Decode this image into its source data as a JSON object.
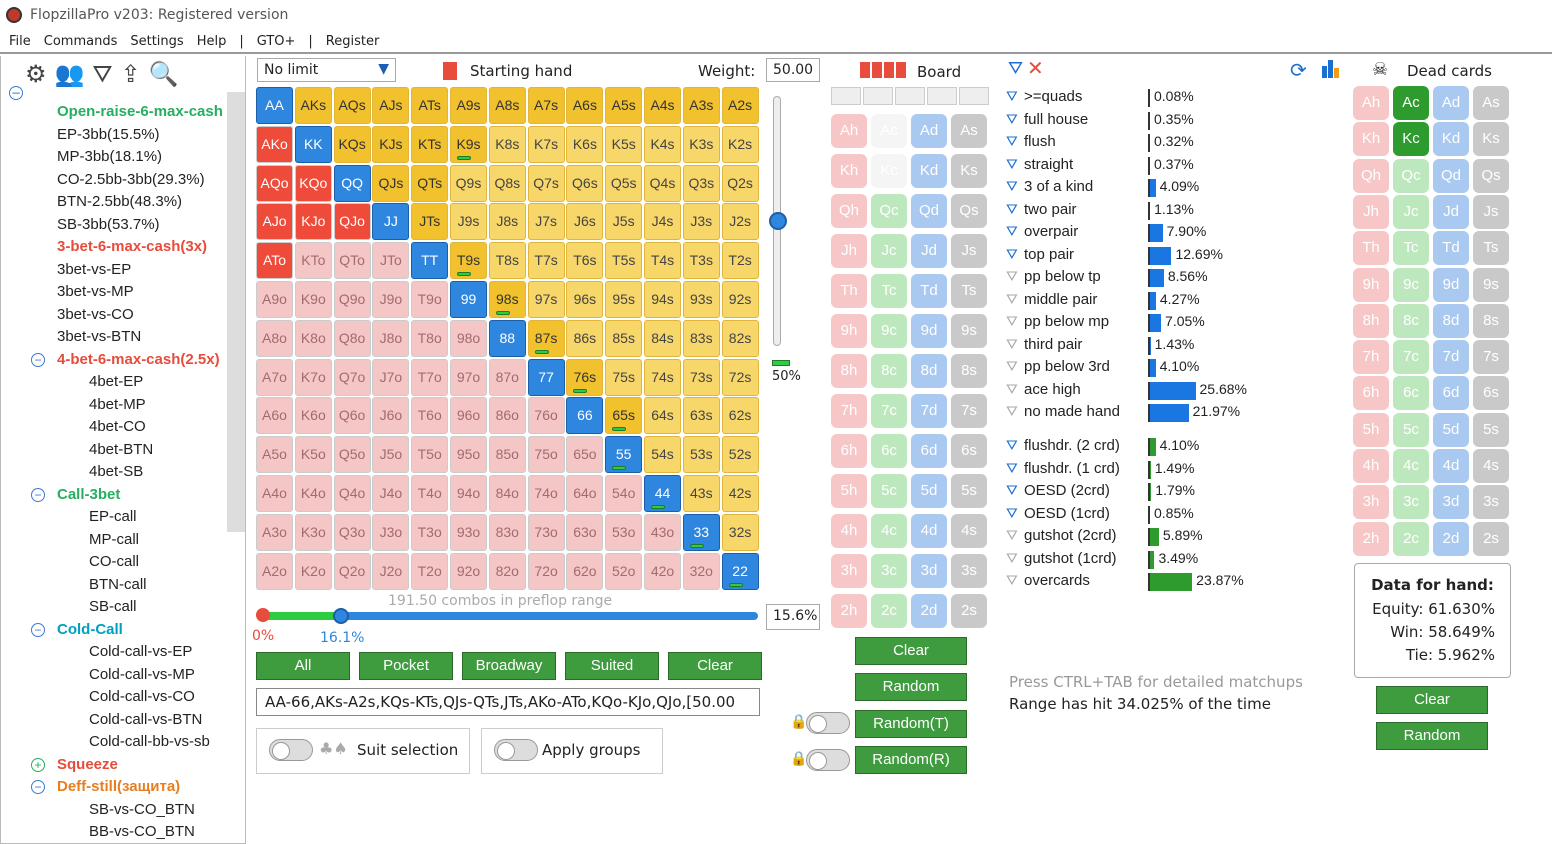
{
  "titlebar": {
    "title": "FlopzillaPro v203: Registered version"
  },
  "menu": [
    "File",
    "Commands",
    "Settings",
    "Help",
    "|",
    "GTO+",
    "|",
    "Register"
  ],
  "tree": {
    "items": [
      {
        "text": "Open-raise-6-max-cash",
        "style": "green"
      },
      {
        "text": "EP-3bb(15.5%)"
      },
      {
        "text": "MP-3bb(18.1%)"
      },
      {
        "text": "CO-2.5bb-3bb(29.3%)"
      },
      {
        "text": "BTN-2.5bb(48.3%)"
      },
      {
        "text": "SB-3bb(53.7%)"
      },
      {
        "text": "3-bet-6-max-cash(3x)",
        "style": "red"
      },
      {
        "text": "3bet-vs-EP"
      },
      {
        "text": "3bet-vs-MP"
      },
      {
        "text": "3bet-vs-CO"
      },
      {
        "text": "3bet-vs-BTN"
      },
      {
        "text": "4-bet-6-max-cash(2.5x)",
        "style": "red"
      },
      {
        "text": "4bet-EP"
      },
      {
        "text": "4bet-MP"
      },
      {
        "text": "4bet-CO"
      },
      {
        "text": "4bet-BTN"
      },
      {
        "text": "4bet-SB"
      },
      {
        "text": "Call-3bet",
        "style": "green"
      },
      {
        "text": "EP-call"
      },
      {
        "text": "MP-call"
      },
      {
        "text": "CO-call"
      },
      {
        "text": "BTN-call"
      },
      {
        "text": "SB-call"
      },
      {
        "text": "Cold-Call",
        "style": "cyan"
      },
      {
        "text": "Cold-call-vs-EP"
      },
      {
        "text": "Cold-call-vs-MP"
      },
      {
        "text": "Cold-call-vs-CO"
      },
      {
        "text": "Cold-call-vs-BTN"
      },
      {
        "text": "Cold-call-bb-vs-sb"
      },
      {
        "text": "Squeeze",
        "style": "red"
      },
      {
        "text": "Deff-still(защита)",
        "style": "orange"
      },
      {
        "text": "SB-vs-CO_BTN"
      },
      {
        "text": "BB-vs-CO_BTN"
      }
    ]
  },
  "range": {
    "limit": "No limit",
    "starting_hand_label": "Starting hand",
    "weight_label": "Weight:",
    "weight_value": "50.00",
    "slider_pct": "50%",
    "combos": "191.50 combos in preflop range",
    "pct_left": "0%",
    "pct_mid": "16.1%",
    "pct_value": "15.6%",
    "buttons": [
      "All",
      "Pocket",
      "Broadway",
      "Suited",
      "Clear"
    ],
    "range_text": "AA-66,AKs-A2s,KQs-KTs,QJs-QTs,JTs,AKo-ATo,KQo-KJo,QJo,[50.00",
    "suit_selection": "Suit selection",
    "apply_groups": "Apply groups"
  },
  "grid_labels": [
    [
      "AA",
      "AKs",
      "AQs",
      "AJs",
      "ATs",
      "A9s",
      "A8s",
      "A7s",
      "A6s",
      "A5s",
      "A4s",
      "A3s",
      "A2s"
    ],
    [
      "AKo",
      "KK",
      "KQs",
      "KJs",
      "KTs",
      "K9s",
      "K8s",
      "K7s",
      "K6s",
      "K5s",
      "K4s",
      "K3s",
      "K2s"
    ],
    [
      "AQo",
      "KQo",
      "QQ",
      "QJs",
      "QTs",
      "Q9s",
      "Q8s",
      "Q7s",
      "Q6s",
      "Q5s",
      "Q4s",
      "Q3s",
      "Q2s"
    ],
    [
      "AJo",
      "KJo",
      "QJo",
      "JJ",
      "JTs",
      "J9s",
      "J8s",
      "J7s",
      "J6s",
      "J5s",
      "J4s",
      "J3s",
      "J2s"
    ],
    [
      "ATo",
      "KTo",
      "QTo",
      "JTo",
      "TT",
      "T9s",
      "T8s",
      "T7s",
      "T6s",
      "T5s",
      "T4s",
      "T3s",
      "T2s"
    ],
    [
      "A9o",
      "K9o",
      "Q9o",
      "J9o",
      "T9o",
      "99",
      "98s",
      "97s",
      "96s",
      "95s",
      "94s",
      "93s",
      "92s"
    ],
    [
      "A8o",
      "K8o",
      "Q8o",
      "J8o",
      "T8o",
      "98o",
      "88",
      "87s",
      "86s",
      "85s",
      "84s",
      "83s",
      "82s"
    ],
    [
      "A7o",
      "K7o",
      "Q7o",
      "J7o",
      "T7o",
      "97o",
      "87o",
      "77",
      "76s",
      "75s",
      "74s",
      "73s",
      "72s"
    ],
    [
      "A6o",
      "K6o",
      "Q6o",
      "J6o",
      "T6o",
      "96o",
      "86o",
      "76o",
      "66",
      "65s",
      "64s",
      "63s",
      "62s"
    ],
    [
      "A5o",
      "K5o",
      "Q5o",
      "J5o",
      "T5o",
      "95o",
      "85o",
      "75o",
      "65o",
      "55",
      "54s",
      "53s",
      "52s"
    ],
    [
      "A4o",
      "K4o",
      "Q4o",
      "J4o",
      "T4o",
      "94o",
      "84o",
      "74o",
      "64o",
      "54o",
      "44",
      "43s",
      "42s"
    ],
    [
      "A3o",
      "K3o",
      "Q3o",
      "J3o",
      "T3o",
      "93o",
      "83o",
      "73o",
      "63o",
      "53o",
      "43o",
      "33",
      "32s"
    ],
    [
      "A2o",
      "K2o",
      "Q2o",
      "J2o",
      "T2o",
      "92o",
      "82o",
      "72o",
      "62o",
      "52o",
      "42o",
      "32o",
      "22"
    ]
  ],
  "selected_hands": [
    "AA",
    "AKs",
    "AQs",
    "AJs",
    "ATs",
    "A9s",
    "A8s",
    "A7s",
    "A6s",
    "A5s",
    "A4s",
    "A3s",
    "A2s",
    "AKo",
    "KK",
    "KQs",
    "KJs",
    "KTs",
    "K9s",
    "AQo",
    "KQo",
    "QQ",
    "QJs",
    "QTs",
    "AJo",
    "KJo",
    "QJo",
    "JJ",
    "JTs",
    "ATo",
    "TT",
    "T9s",
    "99",
    "98s",
    "88",
    "87s",
    "77",
    "76s",
    "66",
    "65s",
    "55",
    "44",
    "33",
    "22"
  ],
  "half_hands": [
    "K9s",
    "T9s",
    "98s",
    "87s",
    "76s",
    "65s",
    "55",
    "44",
    "33",
    "22"
  ],
  "board": {
    "label": "Board",
    "ranks": [
      "A",
      "K",
      "Q",
      "J",
      "T",
      "9",
      "8",
      "7",
      "6",
      "5",
      "4",
      "3",
      "2"
    ],
    "suits": [
      "h",
      "c",
      "d",
      "s"
    ],
    "dim_cards": [
      "Ac",
      "Kc"
    ],
    "clear": "Clear",
    "random": "Random",
    "random_t": "Random(T)",
    "random_r": "Random(R)"
  },
  "stats": {
    "rows": [
      {
        "label": ">=quads",
        "val": "0.08%",
        "pct": 0.08,
        "color": "blue",
        "filter": true
      },
      {
        "label": "full house",
        "val": "0.35%",
        "pct": 0.35,
        "color": "blue",
        "filter": true
      },
      {
        "label": "flush",
        "val": "0.32%",
        "pct": 0.32,
        "color": "blue",
        "filter": true
      },
      {
        "label": "straight",
        "val": "0.37%",
        "pct": 0.37,
        "color": "blue",
        "filter": true
      },
      {
        "label": "3 of a kind",
        "val": "4.09%",
        "pct": 4.09,
        "color": "blue",
        "filter": true
      },
      {
        "label": "two pair",
        "val": "1.13%",
        "pct": 1.13,
        "color": "blue",
        "filter": true
      },
      {
        "label": "overpair",
        "val": "7.90%",
        "pct": 7.9,
        "color": "blue",
        "filter": true
      },
      {
        "label": "top pair",
        "val": "12.69%",
        "pct": 12.69,
        "color": "blue",
        "filter": true
      },
      {
        "label": "pp below tp",
        "val": "8.56%",
        "pct": 8.56,
        "color": "blue",
        "filter": false
      },
      {
        "label": "middle pair",
        "val": "4.27%",
        "pct": 4.27,
        "color": "blue",
        "filter": false
      },
      {
        "label": "pp below mp",
        "val": "7.05%",
        "pct": 7.05,
        "color": "blue",
        "filter": false
      },
      {
        "label": "third pair",
        "val": "1.43%",
        "pct": 1.43,
        "color": "blue",
        "filter": false
      },
      {
        "label": "pp below 3rd",
        "val": "4.10%",
        "pct": 4.1,
        "color": "blue",
        "filter": false
      },
      {
        "label": "ace high",
        "val": "25.68%",
        "pct": 25.68,
        "color": "blue",
        "filter": false
      },
      {
        "label": "no made hand",
        "val": "21.97%",
        "pct": 21.97,
        "color": "blue",
        "filter": false
      }
    ],
    "draws": [
      {
        "label": "flushdr. (2 crd)",
        "val": "4.10%",
        "pct": 4.1,
        "filter": true
      },
      {
        "label": "flushdr. (1 crd)",
        "val": "1.49%",
        "pct": 1.49,
        "filter": true
      },
      {
        "label": "OESD (2crd)",
        "val": "1.79%",
        "pct": 1.79,
        "filter": true
      },
      {
        "label": "OESD (1crd)",
        "val": "0.85%",
        "pct": 0.85,
        "filter": true
      },
      {
        "label": "gutshot (2crd)",
        "val": "5.89%",
        "pct": 5.89,
        "filter": false
      },
      {
        "label": "gutshot (1crd)",
        "val": "3.49%",
        "pct": 3.49,
        "filter": false
      },
      {
        "label": "overcards",
        "val": "23.87%",
        "pct": 23.87,
        "filter": false
      }
    ],
    "hint": "Press CTRL+TAB for detailed matchups",
    "hit": "Range has hit 34.025% of the time"
  },
  "dead": {
    "label": "Dead cards",
    "full_cards": [
      "Ac",
      "Kc"
    ],
    "data_title": "Data for hand:",
    "equity": "Equity: 61.630%",
    "win": "Win: 58.649%",
    "tie": "Tie: 5.962%",
    "clear": "Clear",
    "random": "Random"
  }
}
